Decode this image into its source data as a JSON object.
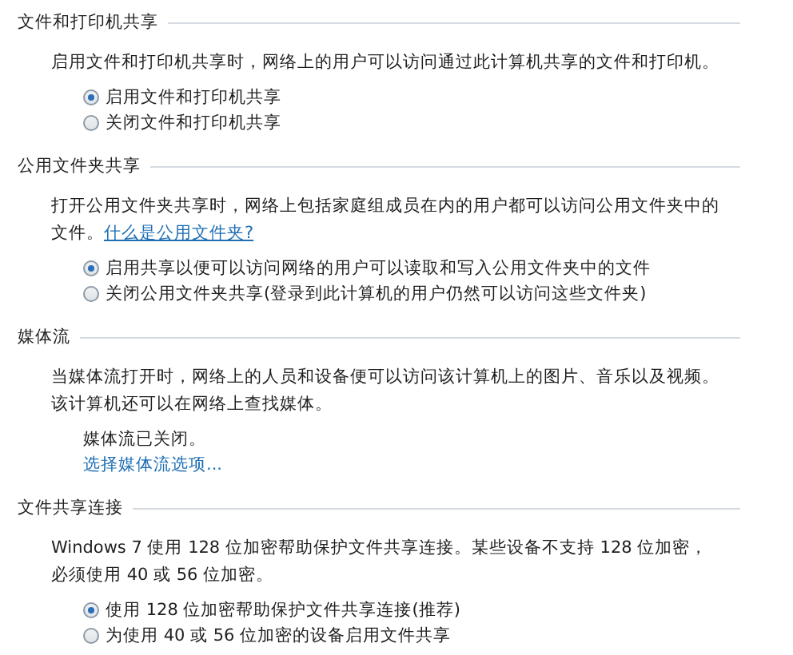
{
  "sections": [
    {
      "title": "文件和打印机共享",
      "description": "启用文件和打印机共享时，网络上的用户可以访问通过此计算机共享的文件和打印机。",
      "items": [
        {
          "kind": "radio",
          "label": "启用文件和打印机共享",
          "selected": true
        },
        {
          "kind": "radio",
          "label": "关闭文件和打印机共享",
          "selected": false
        }
      ]
    },
    {
      "title": "公用文件夹共享",
      "description": "打开公用文件夹共享时，网络上包括家庭组成员在内的用户都可以访问公用文件夹中的文件。",
      "description_link": "什么是公用文件夹?",
      "items": [
        {
          "kind": "radio",
          "label": "启用共享以便可以访问网络的用户可以读取和写入公用文件夹中的文件",
          "selected": true
        },
        {
          "kind": "radio",
          "label": "关闭公用文件夹共享(登录到此计算机的用户仍然可以访问这些文件夹)",
          "selected": false
        }
      ]
    },
    {
      "title": "媒体流",
      "description": "当媒体流打开时，网络上的人员和设备便可以访问该计算机上的图片、音乐以及视频。该计算机还可以在网络上查找媒体。",
      "items": [
        {
          "kind": "status",
          "label": "媒体流已关闭。"
        },
        {
          "kind": "link",
          "label": "选择媒体流选项..."
        }
      ]
    },
    {
      "title": "文件共享连接",
      "description": "Windows 7 使用 128 位加密帮助保护文件共享连接。某些设备不支持 128 位加密，必须使用 40 或 56 位加密。",
      "items": [
        {
          "kind": "radio",
          "label": "使用 128 位加密帮助保护文件共享连接(推荐)",
          "selected": true
        },
        {
          "kind": "radio",
          "label": "为使用 40 或 56 位加密的设备启用文件共享",
          "selected": false
        }
      ]
    }
  ]
}
